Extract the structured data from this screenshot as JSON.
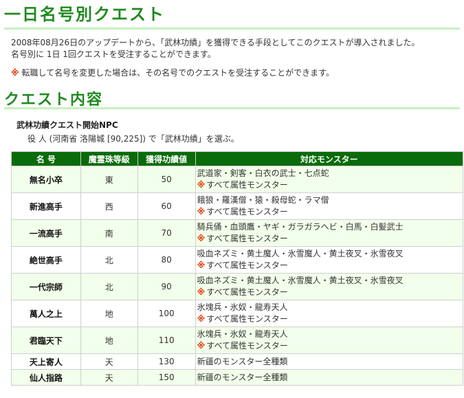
{
  "heading1": "一日名号別クエスト",
  "intro": {
    "line1": "2008年08月26日のアップデートから、「武林功績」を獲得できる手段としてこのクエストが導入されました。",
    "line2": "名号別に 1日 1回クエストを受注することができます。",
    "note_mark": "※",
    "note": "転職して名号を変更した場合は、その名号でのクエストを受注することができます。"
  },
  "heading2": "クエスト内容",
  "npc": {
    "title": "武林功績クエスト開始NPC",
    "line": "役 人 (河南省 洛陽城 [90,225]) で「武林功績」を選ぶ。"
  },
  "table": {
    "headers": [
      "名 号",
      "魔霊珠等級",
      "獲得功績値",
      "対応モンスター"
    ],
    "note_mark": "※",
    "rows": [
      {
        "name": "無名小卒",
        "grade": "東",
        "points": "50",
        "monsters": "武道家・剣客・白衣の武士・七点蛇",
        "extra": "すべて属性モンスター"
      },
      {
        "name": "新進高手",
        "grade": "西",
        "points": "60",
        "monsters": "餓狼・羅漢僧・猿・殺母蛇・ラマ僧",
        "extra": "すべて属性モンスター"
      },
      {
        "name": "一流高手",
        "grade": "南",
        "points": "70",
        "monsters": "騎兵俑・血頭鷹・ヤギ・ガラガラヘビ・白馬・白髪武士",
        "extra": "すべて属性モンスター"
      },
      {
        "name": "絶世高手",
        "grade": "北",
        "points": "80",
        "monsters": "吸血ネズミ・黄土魔人・氷雪魔人・黄土夜叉・氷雪夜叉",
        "extra": "すべて属性モンスター"
      },
      {
        "name": "一代宗師",
        "grade": "北",
        "points": "90",
        "monsters": "吸血ネズミ・黄土魔人・氷雪魔人・黄土夜叉・氷雪夜叉",
        "extra": "すべて属性モンスター"
      },
      {
        "name": "萬人之上",
        "grade": "地",
        "points": "100",
        "monsters": "氷塊兵・氷奴・龍寿天人",
        "extra": "すべて属性モンスター"
      },
      {
        "name": "君臨天下",
        "grade": "地",
        "points": "110",
        "monsters": "氷塊兵・氷奴・龍寿天人",
        "extra": "すべて属性モンスター"
      },
      {
        "name": "天上寄人",
        "grade": "天",
        "points": "130",
        "monsters": "新疆のモンスター全種類",
        "extra": ""
      },
      {
        "name": "仙人指路",
        "grade": "天",
        "points": "150",
        "monsters": "新疆のモンスター全種類",
        "extra": ""
      }
    ]
  }
}
